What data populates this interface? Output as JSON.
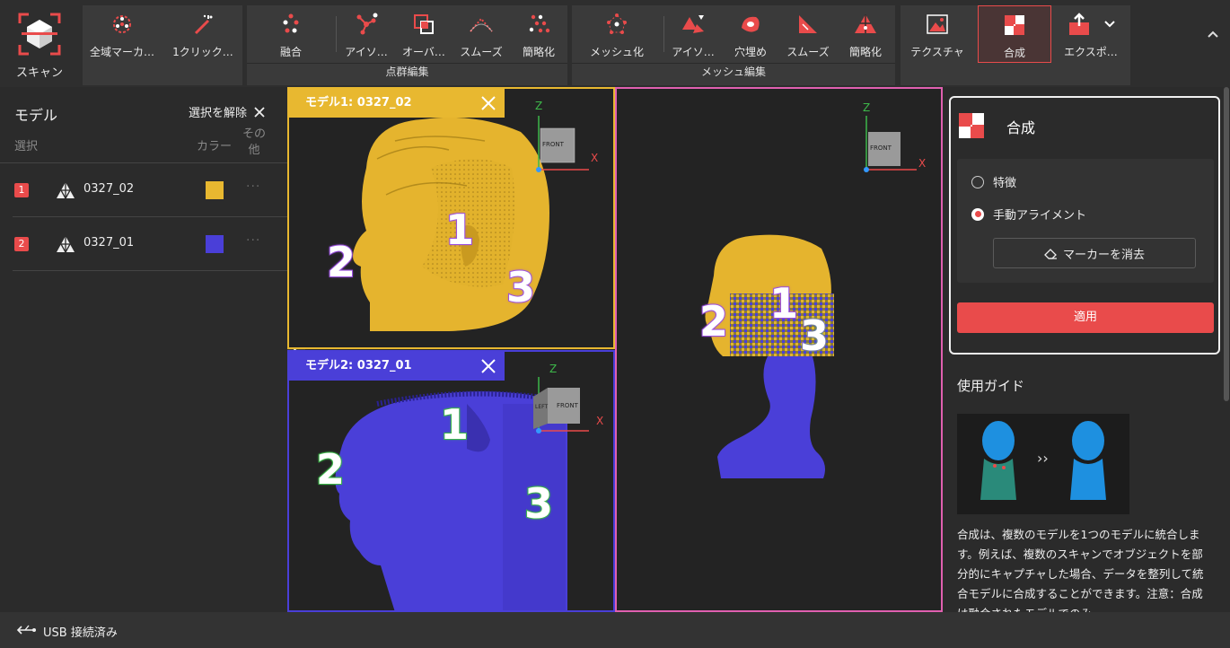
{
  "toolbar": {
    "scan": "スキャン",
    "global_marker": "全域マーカ…",
    "one_click": "1クリック…",
    "fusion": "融合",
    "pc_isolate": "アイソ…",
    "pc_overlap": "オーバ…",
    "pc_smooth": "スムーズ",
    "pc_simplify": "簡略化",
    "meshing": "メッシュ化",
    "mesh_isolate": "アイソ…",
    "mesh_fill": "穴埋め",
    "mesh_smooth": "スムーズ",
    "mesh_simplify": "簡略化",
    "texture": "テクスチャ",
    "merge": "合成",
    "export": "エクスポ…",
    "group_pointcloud": "点群編集",
    "group_mesh": "メッシュ編集"
  },
  "models_panel": {
    "title": "モデル",
    "deselect": "選択を解除",
    "col_select": "選択",
    "col_color": "カラー",
    "col_other": "その他",
    "items": [
      {
        "index": "1",
        "name": "0327_02",
        "color": "#E8B830",
        "more": "···"
      },
      {
        "index": "2",
        "name": "0327_01",
        "color": "#4A3FD8",
        "more": "···"
      }
    ]
  },
  "viewports": {
    "model1_title": "モデル1: 0327_02",
    "model2_title": "モデル2: 0327_01",
    "axis_x": "X",
    "axis_z": "Z",
    "cube_front": "FRONT",
    "cube_left": "LEFT",
    "markers": [
      "1",
      "2",
      "3"
    ]
  },
  "merge_panel": {
    "title": "合成",
    "option_feature": "特徴",
    "option_manual": "手動アライメント",
    "selected_option": "手動アライメント",
    "clear_markers": "マーカーを消去",
    "apply": "適用"
  },
  "guide": {
    "title": "使用ガイド",
    "arrow": "››",
    "text": "合成は、複数のモデルを1つのモデルに統合します。例えば、複数のスキャンでオブジェクトを部分的にキャプチャした場合、データを整列して統合モデルに合成することができます。注意：合成は融合されたモデルでのみ"
  },
  "status": {
    "usb": "USB 接続済み"
  },
  "colors": {
    "accent": "#E94B4B",
    "model1": "#E8B830",
    "model2": "#4A3FD8",
    "merge_border": "#E060B0",
    "marker_purple": "#9B4FE0",
    "marker_green": "#3DB84A"
  }
}
